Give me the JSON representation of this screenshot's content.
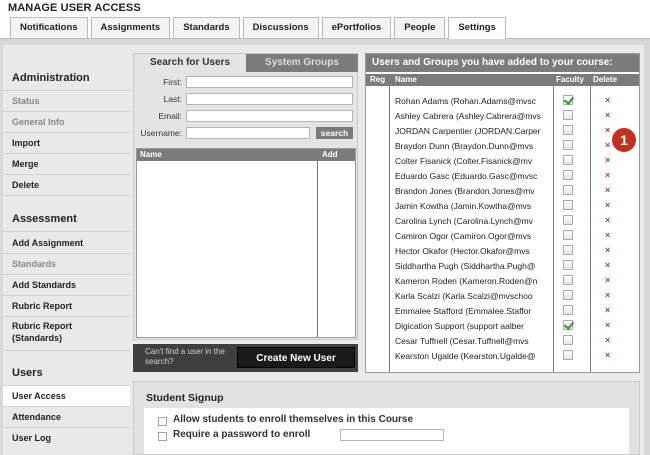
{
  "page": {
    "title": "MANAGE USER ACCESS"
  },
  "tabs": [
    {
      "label": "Notifications",
      "active": false
    },
    {
      "label": "Assignments",
      "active": false
    },
    {
      "label": "Standards",
      "active": false
    },
    {
      "label": "Discussions",
      "active": false
    },
    {
      "label": "ePortfolios",
      "active": false
    },
    {
      "label": "People",
      "active": false
    },
    {
      "label": "Settings",
      "active": true
    }
  ],
  "sidebar": {
    "administration": {
      "title": "Administration",
      "items": [
        {
          "label": "Status",
          "muted": true
        },
        {
          "label": "General Info",
          "muted": true
        },
        {
          "label": "Import",
          "muted": false
        },
        {
          "label": "Merge",
          "muted": false
        },
        {
          "label": "Delete",
          "muted": false
        }
      ]
    },
    "assessment": {
      "title": "Assessment",
      "items": [
        {
          "label": "Add Assignment",
          "muted": false
        },
        {
          "label": "Standards",
          "muted": true
        },
        {
          "label": "Add Standards",
          "muted": false
        },
        {
          "label": "Rubric Report",
          "muted": false
        },
        {
          "label": "Rubric Report\n(Standards)",
          "muted": false
        }
      ]
    },
    "users": {
      "title": "Users",
      "items": [
        {
          "label": "User Access",
          "active": true
        },
        {
          "label": "Attendance",
          "active": false
        },
        {
          "label": "User Log",
          "active": false
        }
      ]
    }
  },
  "search": {
    "tab_active": "Search for Users",
    "tab_inactive": "System Groups",
    "first_label": "First:",
    "last_label": "Last:",
    "email_label": "Email:",
    "username_label": "Username:",
    "search_button": "search",
    "results_col_name": "Name",
    "results_col_add": "Add",
    "cant_find": "Can't find a user in the search?",
    "create_button": "Create New User"
  },
  "course_users": {
    "title": "Users and Groups you have added to your course:",
    "col_reg": "Reg",
    "col_name": "Name",
    "col_faculty": "Faculty",
    "col_delete": "Delete",
    "delete_glyph": "×",
    "rows": [
      {
        "name": "Rohan Adams (Rohan.Adams@mvsc",
        "faculty": true
      },
      {
        "name": "Ashley Cabrera (Ashley.Cabrera@mvs",
        "faculty": false
      },
      {
        "name": "JORDAN Carpentier (JORDAN.Carper",
        "faculty": false
      },
      {
        "name": "Braydon Dunn (Braydon.Dunn@mvs",
        "faculty": false
      },
      {
        "name": "Colter Fisanick (Colter.Fisanick@mv",
        "faculty": false
      },
      {
        "name": "Eduardo Gasc (Eduardo.Gasc@mvsc",
        "faculty": false
      },
      {
        "name": "Brandon Jones (Brandon.Jones@mv",
        "faculty": false
      },
      {
        "name": "Jamin Kowtha (Jamin.Kowtha@mvs",
        "faculty": false
      },
      {
        "name": "Carolina Lynch (Carolina.Lynch@mv",
        "faculty": false
      },
      {
        "name": "Camiron Ogor (Camiron.Ogor@mvs",
        "faculty": false
      },
      {
        "name": "Hector Okafor (Hector.Okafor@mvs",
        "faculty": false
      },
      {
        "name": "Siddhartha Pugh (Siddhartha.Pugh@",
        "faculty": false
      },
      {
        "name": "Kameron Roden (Kameron.Roden@n",
        "faculty": false
      },
      {
        "name": "Karla Scalzi (Karla.Scalzi@mvschoo",
        "faculty": false
      },
      {
        "name": "Emmalee Stafford (Emmalee.Staffor",
        "faculty": false
      },
      {
        "name": "Digication Support (support aalber",
        "faculty": true
      },
      {
        "name": "Cesar Tuffnell (Cesar.Tuffnell@mvs",
        "faculty": false
      },
      {
        "name": "Kearston Ugalde (Kearston.Ugalde@",
        "faculty": false
      }
    ]
  },
  "callout": {
    "label": "1"
  },
  "signup": {
    "title": "Student Signup",
    "allow_label": "Allow students to enroll themselves in this Course",
    "password_label": "Require a password to enroll"
  }
}
